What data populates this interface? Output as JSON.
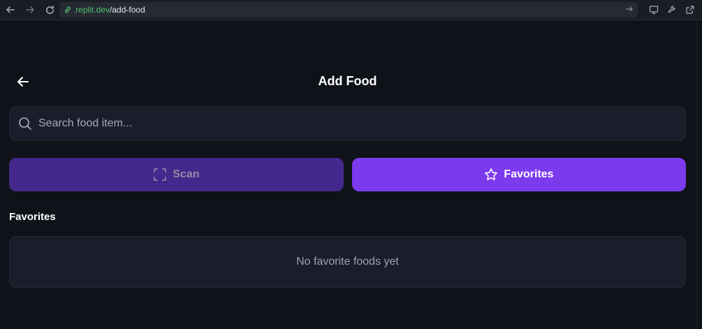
{
  "browser": {
    "url_host": ".replit.dev",
    "url_path": "/add-food",
    "icons": [
      "back-icon",
      "forward-icon",
      "reload-icon",
      "link-icon",
      "go-icon",
      "monitor-icon",
      "wrench-icon",
      "external-link-icon"
    ]
  },
  "header": {
    "title": "Add Food",
    "back_icon": "arrow-left-icon"
  },
  "search": {
    "placeholder": "Search food item...",
    "value": ""
  },
  "actions": {
    "scan_label": "Scan",
    "favorites_label": "Favorites",
    "colors": {
      "scan_bg": "#44288b",
      "favorites_bg": "#7c3aed"
    }
  },
  "favorites": {
    "title": "Favorites",
    "empty_message": "No favorite foods yet"
  }
}
